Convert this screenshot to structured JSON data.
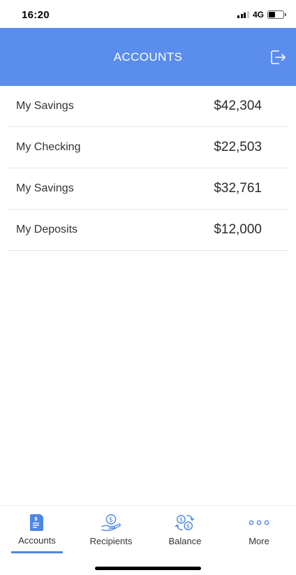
{
  "status_bar": {
    "time": "16:20",
    "network": "4G",
    "battery_level": 0.45
  },
  "header": {
    "title": "ACCOUNTS",
    "logout_icon": "logout-icon",
    "color": "#5a8ded"
  },
  "accounts": [
    {
      "name": "My Savings",
      "amount": "$42,304"
    },
    {
      "name": "My Checking",
      "amount": "$22,503"
    },
    {
      "name": "My Savings",
      "amount": "$32,761"
    },
    {
      "name": "My Deposits",
      "amount": "$12,000"
    }
  ],
  "tab_bar": {
    "tabs": [
      {
        "label": "Accounts",
        "icon": "document-icon",
        "active": true
      },
      {
        "label": "Recipients",
        "icon": "money-hand-icon",
        "active": false
      },
      {
        "label": "Balance",
        "icon": "exchange-icon",
        "active": false
      },
      {
        "label": "More",
        "icon": "more-dots-icon",
        "active": false
      }
    ],
    "accent": "#4d86e6"
  }
}
